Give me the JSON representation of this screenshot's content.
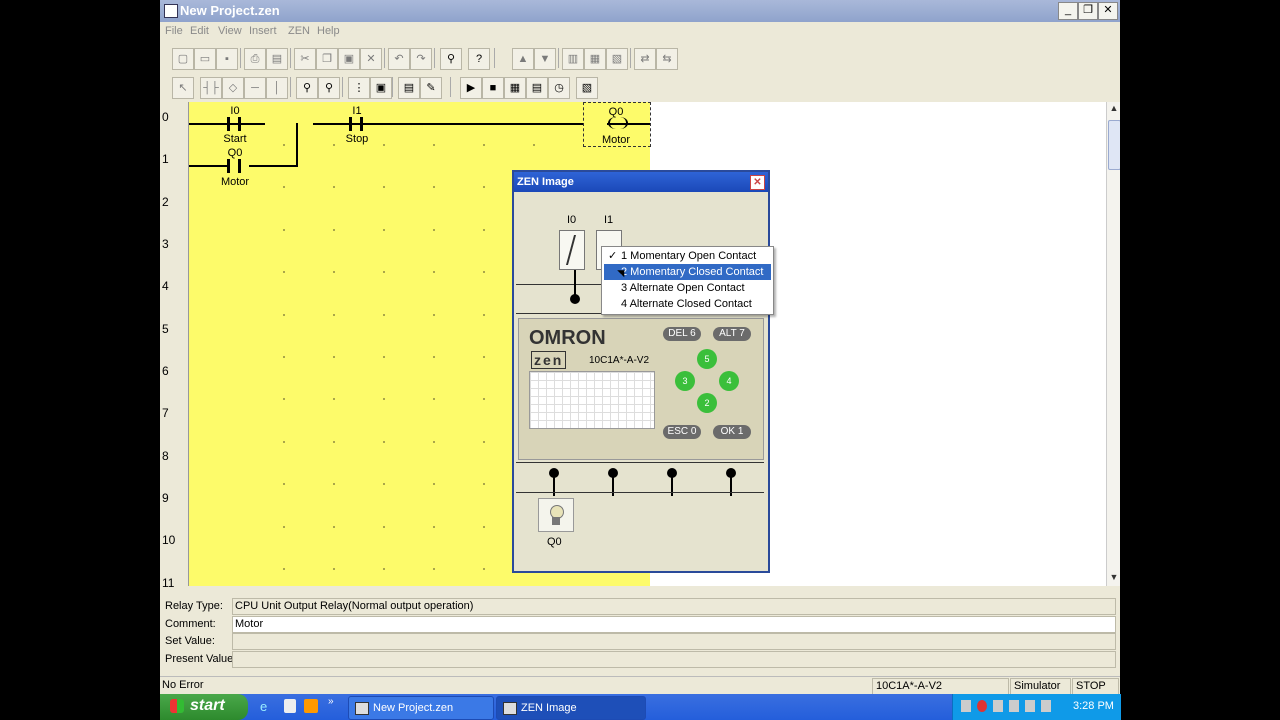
{
  "window": {
    "title": "New Project.zen",
    "minimize": "_",
    "restore": "❐",
    "close": "✕"
  },
  "menu": [
    "File",
    "Edit",
    "View",
    "Insert",
    "ZEN",
    "Help"
  ],
  "ladder": {
    "row_numbers": [
      "0",
      "1",
      "2",
      "3",
      "4",
      "5",
      "6",
      "7",
      "8",
      "9",
      "10",
      "11"
    ],
    "contacts": [
      {
        "address": "I0",
        "comment": "Start"
      },
      {
        "address": "I1",
        "comment": "Stop"
      },
      {
        "address": "Q0",
        "comment": "Motor"
      }
    ],
    "coil": {
      "address": "Q0",
      "comment": "Motor"
    }
  },
  "info": {
    "relay_type_label": "Relay Type:",
    "relay_type_value": "CPU Unit Output Relay(Normal output operation)",
    "comment_label": "Comment:",
    "comment_value": "Motor",
    "set_value_label": "Set Value:",
    "set_value_value": "",
    "present_value_label": "Present Value:",
    "present_value_value": ""
  },
  "status": {
    "error": "No Error",
    "model": "10C1A*-A-V2",
    "mode": "Simulator",
    "run_state": "STOP"
  },
  "zen_image": {
    "title": "ZEN Image",
    "close": "✕",
    "input_labels": [
      "I0",
      "I1"
    ],
    "brand": "OMRON",
    "logo": "zen",
    "model": "10C1A*-A-V2",
    "buttons": {
      "del": "DEL 6",
      "alt": "ALT 7",
      "esc": "ESC 0",
      "ok": "OK  1",
      "up": "5",
      "down": "2",
      "left": "3",
      "right": "4"
    },
    "output_label": "Q0"
  },
  "context_menu": {
    "items": [
      {
        "label": "1 Momentary Open Contact",
        "checked": "✓"
      },
      {
        "label": "2 Momentary Closed Contact",
        "checked": ""
      },
      {
        "label": "3 Alternate Open Contact",
        "checked": ""
      },
      {
        "label": "4 Alternate Closed Contact",
        "checked": ""
      }
    ],
    "selected_index": 1
  },
  "taskbar": {
    "start": "start",
    "tasks": [
      "New Project.zen",
      "ZEN Image"
    ],
    "clock": "3:28 PM"
  },
  "colors": {
    "ladder_bg": "#fdfb6a",
    "titlebar_active": "#2f64d6",
    "selection": "#316ac5"
  }
}
